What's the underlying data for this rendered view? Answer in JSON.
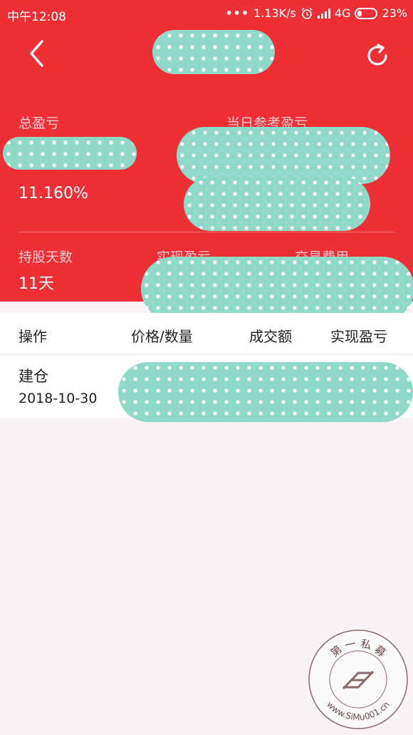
{
  "status_bar": {
    "time": "中午12:08",
    "dots": "•••",
    "speed": "1.13K/s",
    "network": "4G",
    "battery": "23%"
  },
  "summary": {
    "total_pnl_label": "总盈亏",
    "total_pnl_percent": "11.160%",
    "daily_ref_pnl_label": "当日参考盈亏"
  },
  "stats": {
    "holding_days_label": "持股天数",
    "holding_days_value": "11天",
    "realized_pnl_label": "实现盈亏",
    "fees_label": "交易费用"
  },
  "table": {
    "headers": [
      "操作",
      "价格/数量",
      "成交额",
      "实现盈亏"
    ],
    "rows": [
      {
        "operation": "建仓",
        "date": "2018-10-30"
      }
    ]
  },
  "watermark": {
    "text_top": "第 一 私 募",
    "text_bottom": "www.SiMu001.cn"
  },
  "colors": {
    "header_bg": "#ee2f36",
    "redaction": "#8fd9c8",
    "page_bg": "#f7f3f6"
  },
  "icons": [
    "back-arrow-icon",
    "refresh-icon",
    "alarm-icon",
    "signal-icon",
    "battery-icon"
  ]
}
